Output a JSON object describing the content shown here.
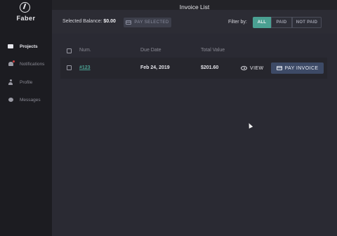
{
  "app": {
    "brand": "Faber",
    "page_title": "Invoice List"
  },
  "sidebar": {
    "items": [
      {
        "label": "Projects",
        "icon": "folder-icon",
        "active": true
      },
      {
        "label": "Notifications",
        "icon": "bell-icon",
        "active": false
      },
      {
        "label": "Profile",
        "icon": "user-icon",
        "active": false
      },
      {
        "label": "Messages",
        "icon": "message-icon",
        "active": false
      }
    ]
  },
  "toolbar": {
    "selected_balance_label": "Selected Balance:",
    "selected_balance_value": "$0.00",
    "pay_selected_label": "PAY SELECTED",
    "filter_label": "Filter by:",
    "filters": [
      "ALL",
      "PAID",
      "NOT PAID"
    ],
    "active_filter": "ALL"
  },
  "table": {
    "headers": [
      "Num.",
      "Due Date",
      "Total Value"
    ],
    "rows": [
      {
        "num": "#123",
        "due_date": "Feb 24, 2019",
        "total": "$201.60",
        "view_label": "VIEW",
        "pay_label": "PAY INVOICE"
      }
    ]
  },
  "colors": {
    "accent": "#4aa092",
    "pay_button": "#3d4a66",
    "sidebar_bg": "#1c1c21",
    "content_bg": "#2a2a33"
  }
}
